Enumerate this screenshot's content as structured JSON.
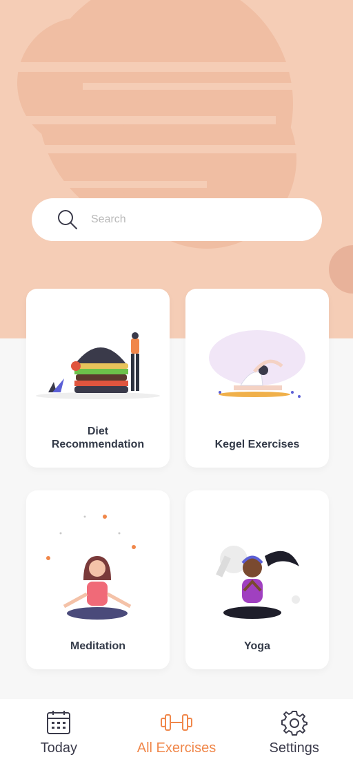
{
  "search": {
    "placeholder": "Search",
    "icon": "search-icon"
  },
  "categories": [
    {
      "label": "Diet\nRecommendation",
      "illustration": "burger-person-illustration"
    },
    {
      "label": "Kegel Exercises",
      "illustration": "stretching-woman-illustration"
    },
    {
      "label": "Meditation",
      "illustration": "meditating-woman-illustration"
    },
    {
      "label": "Yoga",
      "illustration": "yoga-woman-illustration"
    }
  ],
  "tabbar": {
    "items": [
      {
        "label": "Today",
        "icon": "calendar-icon",
        "active": false
      },
      {
        "label": "All Exercises",
        "icon": "dumbbell-icon",
        "active": true
      },
      {
        "label": "Settings",
        "icon": "gear-icon",
        "active": false
      }
    ]
  },
  "colors": {
    "header_bg": "#f5cdb6",
    "accent": "#f0874a",
    "text_dark": "#333a48",
    "page_bg": "#f7f7f7"
  }
}
